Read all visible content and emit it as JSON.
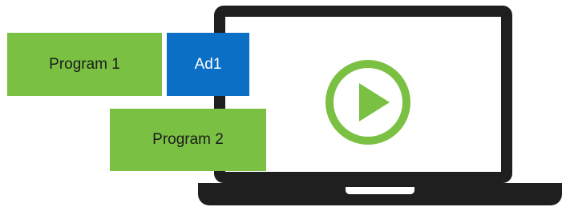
{
  "blocks": {
    "program1": {
      "label": "Program 1",
      "color": "#7ac143"
    },
    "ad1": {
      "label": "Ad1",
      "color": "#0b6fc6"
    },
    "program2": {
      "label": "Program 2",
      "color": "#7ac143"
    }
  },
  "laptop": {
    "frame_color": "#1f1f1f",
    "screen_color": "#ffffff"
  },
  "play_button": {
    "icon": "play-icon",
    "color": "#7ac143"
  }
}
